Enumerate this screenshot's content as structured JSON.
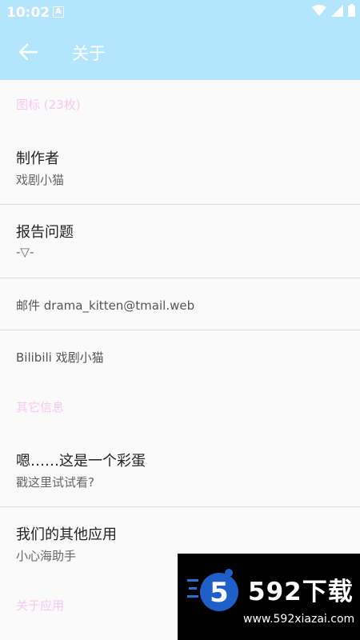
{
  "status": {
    "time": "10:02",
    "notif_glyph": "A"
  },
  "toolbar": {
    "title": "关于",
    "back_icon": "arrow-left-icon"
  },
  "sections": {
    "icons_header": "图标 (23枚)",
    "author": {
      "primary": "制作者",
      "secondary": "戏剧小猫"
    },
    "report": {
      "primary": "报告问题",
      "secondary": "-▽-"
    },
    "email": "邮件 drama_kitten@tmail.web",
    "bilibili": "Bilibili 戏剧小猫",
    "other_header": "其它信息",
    "easter": {
      "primary": "嗯……这是一个彩蛋",
      "secondary": "戳这里试试看?"
    },
    "apps": {
      "primary": "我们的其他应用",
      "secondary": "小心海助手"
    },
    "about_header": "关于应用"
  },
  "watermark": {
    "brand": "592下载",
    "url": "www.592xiazai.com",
    "logo_digit": "5"
  },
  "colors": {
    "appbar": "#b3e5fc",
    "section_header": "#f8c8f0",
    "background": "#fafafa"
  }
}
